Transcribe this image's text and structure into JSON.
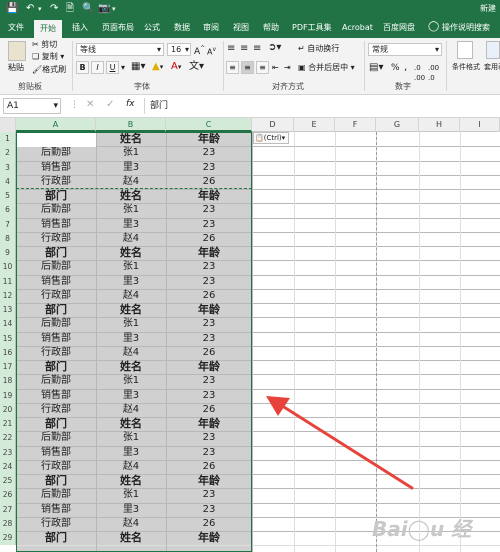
{
  "title_right": "新建",
  "tabs": [
    "文件",
    "开始",
    "插入",
    "页面布局",
    "公式",
    "数据",
    "审阅",
    "视图",
    "帮助",
    "PDF工具集",
    "Acrobat",
    "百度网盘",
    "操作说明搜索"
  ],
  "ribbon": {
    "clipboard": {
      "paste": "粘贴",
      "cut": "剪切",
      "copy": "复制",
      "format_painter": "格式刷",
      "group": "剪贴板"
    },
    "font": {
      "name": "等线",
      "size": "16",
      "bold": "B",
      "italic": "I",
      "underline": "U",
      "group": "字体",
      "grow": "A",
      "shrink": "A"
    },
    "alignment": {
      "wrap": "自动换行",
      "merge": "合并后居中",
      "group": "对齐方式"
    },
    "number": {
      "format": "常规",
      "percent": "%",
      "comma": ",",
      "group": "数字"
    },
    "styles": {
      "conditional": "条件格式",
      "table": "套用表格格式"
    }
  },
  "formula_bar": {
    "name_box": "A1",
    "fx": "fx",
    "content": "部门"
  },
  "columns": [
    "A",
    "B",
    "C",
    "D",
    "E",
    "F",
    "G",
    "H",
    "I"
  ],
  "paste_tag": "(Ctrl)",
  "rows": [
    {
      "n": "1",
      "a": "部门",
      "b": "姓名",
      "c": "年龄",
      "hdr": true
    },
    {
      "n": "2",
      "a": "后勤部",
      "b": "张1",
      "c": "23"
    },
    {
      "n": "3",
      "a": "销售部",
      "b": "里3",
      "c": "23"
    },
    {
      "n": "4",
      "a": "行政部",
      "b": "赵4",
      "c": "26"
    },
    {
      "n": "5",
      "a": "部门",
      "b": "姓名",
      "c": "年龄",
      "hdr": true
    },
    {
      "n": "6",
      "a": "后勤部",
      "b": "张1",
      "c": "23"
    },
    {
      "n": "7",
      "a": "销售部",
      "b": "里3",
      "c": "23"
    },
    {
      "n": "8",
      "a": "行政部",
      "b": "赵4",
      "c": "26"
    },
    {
      "n": "9",
      "a": "部门",
      "b": "姓名",
      "c": "年龄",
      "hdr": true
    },
    {
      "n": "10",
      "a": "后勤部",
      "b": "张1",
      "c": "23"
    },
    {
      "n": "11",
      "a": "销售部",
      "b": "里3",
      "c": "23"
    },
    {
      "n": "12",
      "a": "行政部",
      "b": "赵4",
      "c": "26"
    },
    {
      "n": "13",
      "a": "部门",
      "b": "姓名",
      "c": "年龄",
      "hdr": true
    },
    {
      "n": "14",
      "a": "后勤部",
      "b": "张1",
      "c": "23"
    },
    {
      "n": "15",
      "a": "销售部",
      "b": "里3",
      "c": "23"
    },
    {
      "n": "16",
      "a": "行政部",
      "b": "赵4",
      "c": "26"
    },
    {
      "n": "17",
      "a": "部门",
      "b": "姓名",
      "c": "年龄",
      "hdr": true
    },
    {
      "n": "18",
      "a": "后勤部",
      "b": "张1",
      "c": "23"
    },
    {
      "n": "19",
      "a": "销售部",
      "b": "里3",
      "c": "23"
    },
    {
      "n": "20",
      "a": "行政部",
      "b": "赵4",
      "c": "26"
    },
    {
      "n": "21",
      "a": "部门",
      "b": "姓名",
      "c": "年龄",
      "hdr": true
    },
    {
      "n": "22",
      "a": "后勤部",
      "b": "张1",
      "c": "23"
    },
    {
      "n": "23",
      "a": "销售部",
      "b": "里3",
      "c": "23"
    },
    {
      "n": "24",
      "a": "行政部",
      "b": "赵4",
      "c": "26"
    },
    {
      "n": "25",
      "a": "部门",
      "b": "姓名",
      "c": "年龄",
      "hdr": true
    },
    {
      "n": "26",
      "a": "后勤部",
      "b": "张1",
      "c": "23"
    },
    {
      "n": "27",
      "a": "销售部",
      "b": "里3",
      "c": "23"
    },
    {
      "n": "28",
      "a": "行政部",
      "b": "赵4",
      "c": "26"
    },
    {
      "n": "29",
      "a": "部门",
      "b": "姓名",
      "c": "年龄",
      "hdr": true
    }
  ],
  "colors": {
    "accent": "#217346",
    "selection": "#d0d0d0",
    "arrow": "#e8433a"
  }
}
